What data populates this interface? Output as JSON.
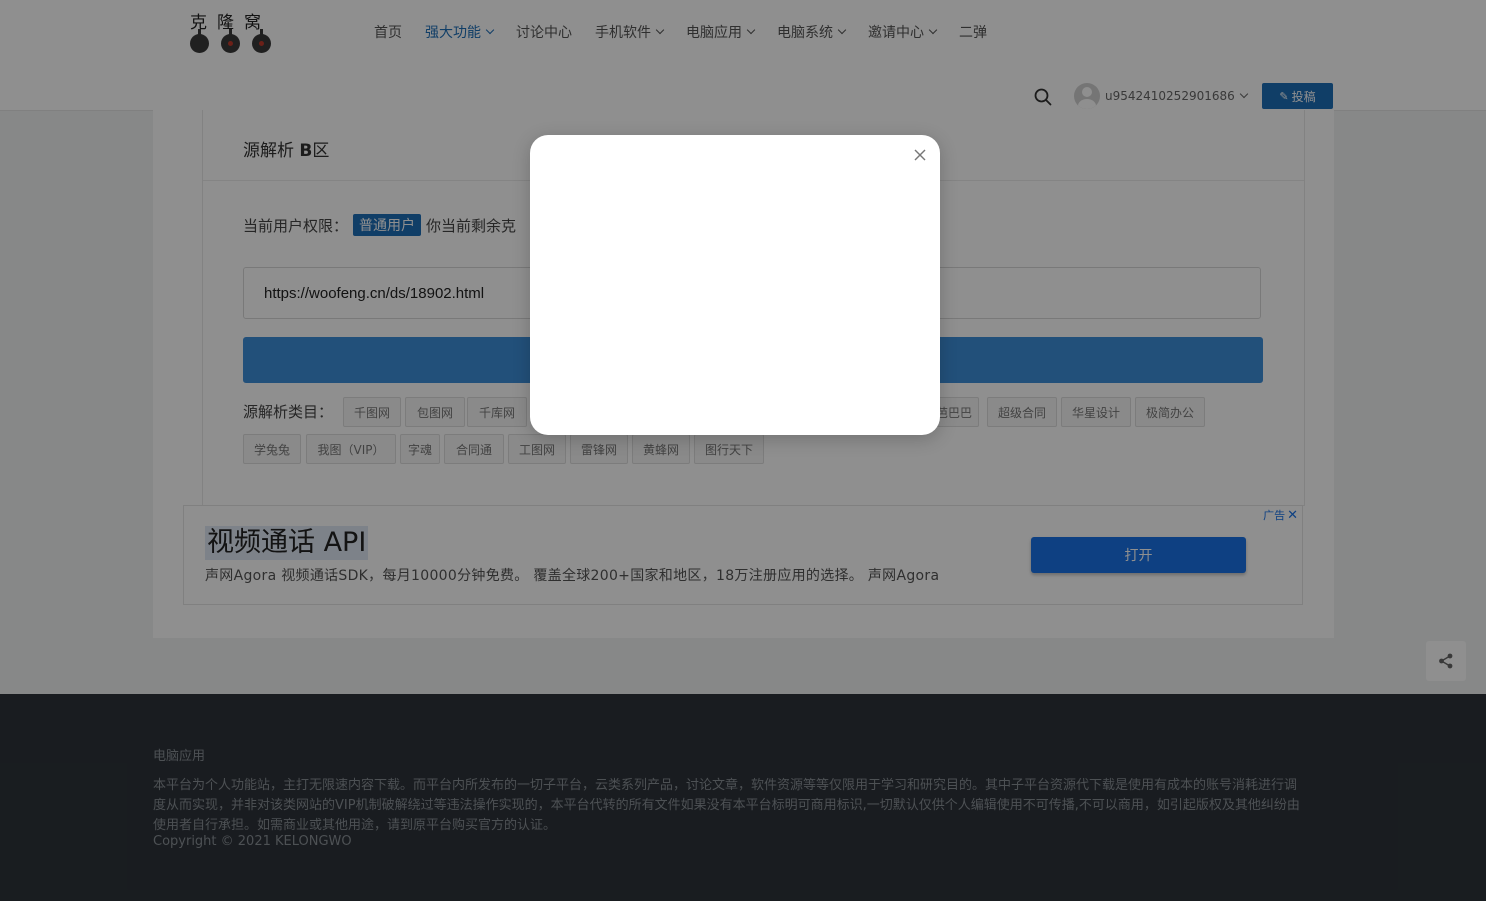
{
  "header": {
    "logo_text": "克隆窝",
    "nav": [
      {
        "label": "首页",
        "dropdown": false,
        "active": false
      },
      {
        "label": "强大功能",
        "dropdown": true,
        "active": true
      },
      {
        "label": "讨论中心",
        "dropdown": false,
        "active": false
      },
      {
        "label": "手机软件",
        "dropdown": true,
        "active": false
      },
      {
        "label": "电脑应用",
        "dropdown": true,
        "active": false
      },
      {
        "label": "电脑系统",
        "dropdown": true,
        "active": false
      },
      {
        "label": "邀请中心",
        "dropdown": true,
        "active": false
      },
      {
        "label": "二弹",
        "dropdown": false,
        "active": false
      }
    ],
    "username": "u9542410252901686",
    "post_label": "投稿",
    "accent_color": "#1e6fb8"
  },
  "card": {
    "title_main": "源解析 ",
    "title_bold": "B",
    "title_tail": "区",
    "permission_label": "当前用户权限：",
    "permission_badge": "普通用户",
    "permission_tail": "你当前剩余克",
    "url_value": "https://woofeng.cn/ds/18902.html",
    "categories_label": "源解析类目：",
    "tags_row1": [
      "千图网",
      "包图网",
      "千库网",
      "芭巴巴",
      "超级合同",
      "华星设计",
      "极简办公"
    ],
    "tags_row2": [
      "学兔兔",
      "我图（VIP）",
      "字魂",
      "合同通",
      "工图网",
      "雷锋网",
      "黄蜂网",
      "图行天下"
    ]
  },
  "ad": {
    "title": "视频通话 API",
    "description": "声网Agora 视频通话SDK，每月10000分钟免费。 覆盖全球200+国家和地区，18万注册应用的选择。 声网Agora",
    "open_label": "打开",
    "mark_label": "广告"
  },
  "footer": {
    "title": "电脑应用",
    "text": "本平台为个人功能站，主打无限速内容下载。而平台内所发布的一切子平台，云类系列产品，讨论文章，软件资源等等仅限用于学习和研究目的。其中子平台资源代下载是使用有成本的账号消耗进行调度从而实现，并非对该类网站的VIP机制破解绕过等违法操作实现的，本平台代转的所有文件如果没有本平台标明可商用标识,一切默认仅供个人编辑使用不可传播,不可以商用，如引起版权及其他纠纷由使用者自行承担。如需商业或其他用途，请到原平台购买官方的认证。",
    "copyright": "Copyright © 2021 KELONGWO"
  },
  "icons": {
    "search": "search-icon",
    "close": "close-icon",
    "share": "share-icon",
    "edit": "edit-icon"
  }
}
